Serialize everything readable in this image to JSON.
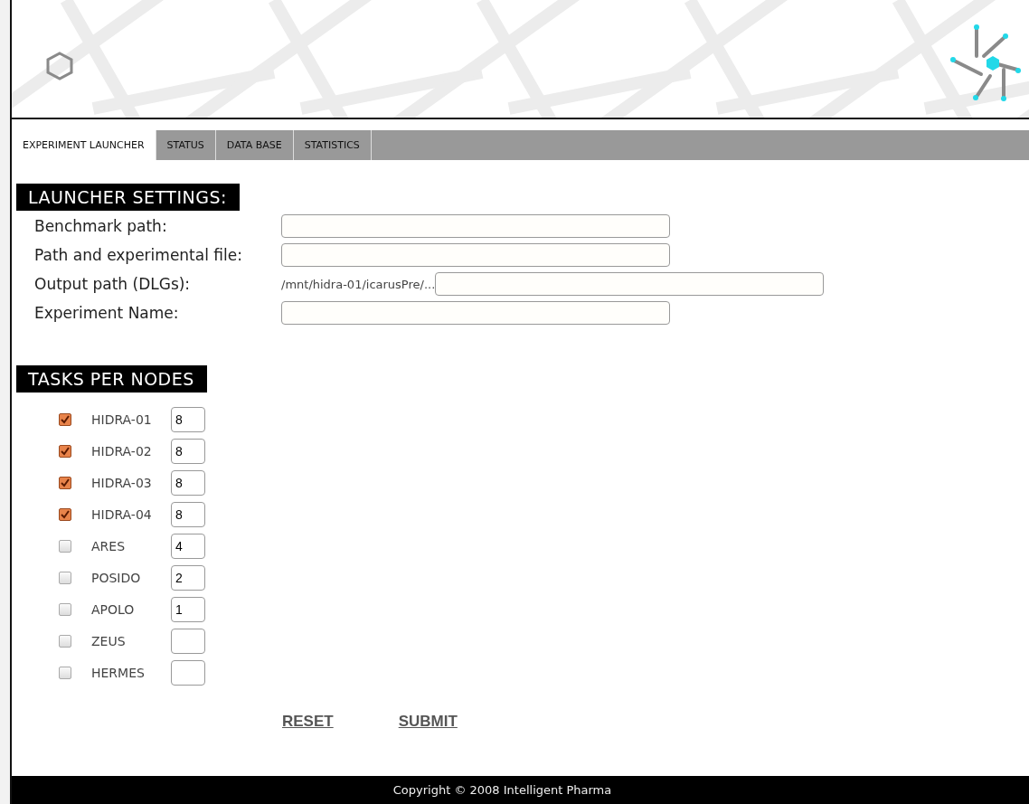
{
  "tabs": [
    {
      "label": "EXPERIMENT LAUNCHER",
      "selected": true
    },
    {
      "label": "STATUS",
      "selected": false
    },
    {
      "label": "DATA BASE",
      "selected": false
    },
    {
      "label": "STATISTICS",
      "selected": false
    }
  ],
  "launcher_settings": {
    "title": "LAUNCHER SETTINGS:",
    "fields": [
      {
        "label": "Benchmark path:",
        "kind": "text"
      },
      {
        "label": "Path and experimental file:",
        "kind": "text"
      },
      {
        "label": "Output path (DLGs):",
        "kind": "prefixed",
        "prefix": "/mnt/hidra-01/icarusPre/..."
      },
      {
        "label": "Experiment Name:",
        "kind": "text"
      }
    ]
  },
  "tasks_per_nodes": {
    "title": "TASKS PER NODES",
    "nodes": [
      {
        "name": "HIDRA-01",
        "checked": true,
        "value": "8"
      },
      {
        "name": "HIDRA-02",
        "checked": true,
        "value": "8"
      },
      {
        "name": "HIDRA-03",
        "checked": true,
        "value": "8"
      },
      {
        "name": "HIDRA-04",
        "checked": true,
        "value": "8"
      },
      {
        "name": "ARES",
        "checked": false,
        "value": "4"
      },
      {
        "name": "POSIDO",
        "checked": false,
        "value": "2"
      },
      {
        "name": "APOLO",
        "checked": false,
        "value": "1"
      },
      {
        "name": "ZEUS",
        "checked": false
      },
      {
        "name": "HERMES",
        "checked": false
      }
    ]
  },
  "buttons": [
    "RESET",
    "SUBMIT"
  ],
  "footer": "Copyright © 2008 Intelligent Pharma"
}
